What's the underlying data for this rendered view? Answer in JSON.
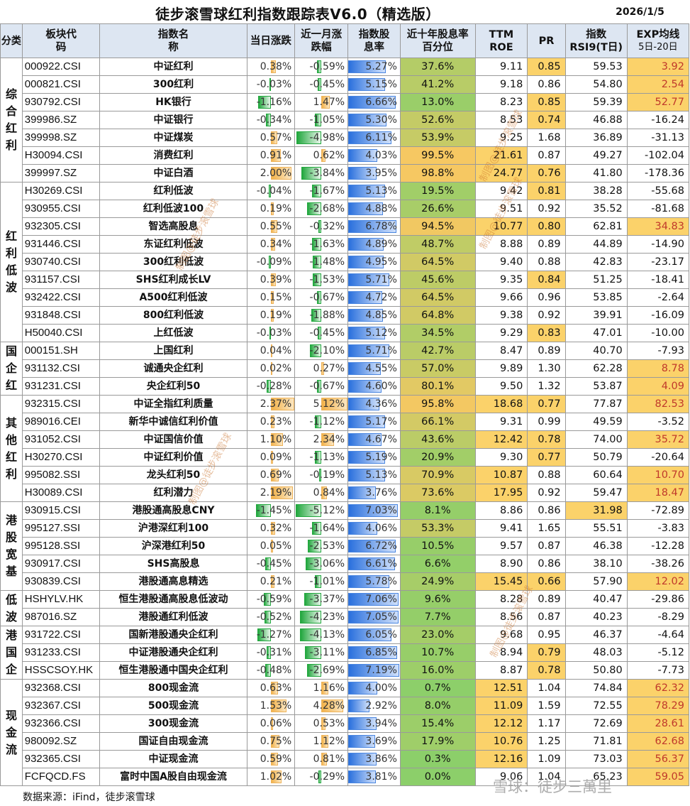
{
  "title": "徒步滚雪球红利指数跟踪表V6.0（精选版）",
  "date": "2026/1/5",
  "headers": {
    "category": "分类",
    "code": "板块代码",
    "name": "指数名称",
    "chg_day": "当日涨跌",
    "chg_month": "近一月涨跌幅",
    "yield": "指数股息率",
    "pctile": "近十年股息率百分位",
    "roe": "TTM ROE",
    "pr": "PR",
    "rsi": "指数RSI9(T日)",
    "exp": "EXP均线",
    "exp_sub": "5日-20日"
  },
  "colors": {
    "pctile_low": "#8ccf6a",
    "pctile_high": "#f7c862",
    "highlight_yellow": "#fbd26a",
    "highlight_pale": "#fdf0c8"
  },
  "groups": [
    {
      "label": "综合红利",
      "rows": [
        {
          "code": "000922.CSI",
          "name": "中证红利",
          "day": "0.38%",
          "month": "-0.59%",
          "yield": "5.27%",
          "pctile": "37.6%",
          "roe": "9.11",
          "pr": "0.85",
          "rsi": "59.53",
          "exp": "3.92"
        },
        {
          "code": "000821.CSI",
          "name": "300红利",
          "day": "-0.03%",
          "month": "-0.45%",
          "yield": "5.15%",
          "pctile": "41.2%",
          "roe": "9.18",
          "pr": "0.86",
          "rsi": "54.80",
          "exp": "2.54"
        },
        {
          "code": "930792.CSI",
          "name": "HK银行",
          "day": "-1.16%",
          "month": "1.47%",
          "yield": "6.66%",
          "pctile": "13.0%",
          "roe": "8.23",
          "pr": "0.85",
          "rsi": "59.39",
          "exp": "52.77"
        },
        {
          "code": "399986.SZ",
          "name": "中证银行",
          "day": "-0.34%",
          "month": "-1.05%",
          "yield": "5.30%",
          "pctile": "52.6%",
          "roe": "8.53",
          "pr": "0.74",
          "rsi": "46.88",
          "exp": "-16.24"
        },
        {
          "code": "399998.SZ",
          "name": "中证煤炭",
          "day": "0.57%",
          "month": "-4.98%",
          "yield": "6.11%",
          "pctile": "53.9%",
          "roe": "9.25",
          "pr": "1.68",
          "rsi": "36.89",
          "exp": "-31.13"
        },
        {
          "code": "H30094.CSI",
          "name": "消费红利",
          "day": "0.91%",
          "month": "0.62%",
          "yield": "4.03%",
          "pctile": "99.5%",
          "roe": "21.61",
          "pr": "0.87",
          "rsi": "49.27",
          "exp": "-102.04"
        },
        {
          "code": "399997.SZ",
          "name": "中证白酒",
          "day": "2.00%",
          "month": "-3.84%",
          "yield": "3.95%",
          "pctile": "98.8%",
          "roe": "24.77",
          "pr": "0.76",
          "rsi": "41.80",
          "exp": "-178.36"
        }
      ]
    },
    {
      "label": "红利低波",
      "rows": [
        {
          "code": "H30269.CSI",
          "name": "红利低波",
          "day": "-0.04%",
          "month": "-1.67%",
          "yield": "5.13%",
          "pctile": "19.5%",
          "roe": "9.42",
          "pr": "0.81",
          "rsi": "38.28",
          "exp": "-55.68"
        },
        {
          "code": "930955.CSI",
          "name": "红利低波100",
          "day": "0.19%",
          "month": "-2.68%",
          "yield": "4.88%",
          "pctile": "26.6%",
          "roe": "9.51",
          "pr": "0.92",
          "rsi": "35.52",
          "exp": "-81.68"
        },
        {
          "code": "932305.CSI",
          "name": "智选高股息",
          "day": "0.55%",
          "month": "-0.32%",
          "yield": "6.78%",
          "pctile": "94.5%",
          "roe": "10.77",
          "pr": "0.80",
          "rsi": "62.81",
          "exp": "34.83"
        },
        {
          "code": "931446.CSI",
          "name": "东证红利低波",
          "day": "0.34%",
          "month": "-1.63%",
          "yield": "4.89%",
          "pctile": "48.7%",
          "roe": "8.88",
          "pr": "0.89",
          "rsi": "44.89",
          "exp": "-14.90"
        },
        {
          "code": "930740.CSI",
          "name": "300红利低波",
          "day": "-0.09%",
          "month": "-1.48%",
          "yield": "4.95%",
          "pctile": "64.5%",
          "roe": "9.40",
          "pr": "0.88",
          "rsi": "42.83",
          "exp": "-23.17"
        },
        {
          "code": "931157.CSI",
          "name": "SHS红利成长LV",
          "day": "0.39%",
          "month": "-1.53%",
          "yield": "5.71%",
          "pctile": "45.6%",
          "roe": "9.35",
          "pr": "0.84",
          "rsi": "51.25",
          "exp": "-18.41"
        },
        {
          "code": "932422.CSI",
          "name": "A500红利低波",
          "day": "0.15%",
          "month": "-0.67%",
          "yield": "4.72%",
          "pctile": "64.5%",
          "roe": "9.66",
          "pr": "0.96",
          "rsi": "53.85",
          "exp": "-2.64"
        },
        {
          "code": "931848.CSI",
          "name": "800红利低波",
          "day": "0.19%",
          "month": "-1.88%",
          "yield": "4.85%",
          "pctile": "64.8%",
          "roe": "9.38",
          "pr": "0.92",
          "rsi": "39.91",
          "exp": "-16.09"
        },
        {
          "code": "H50040.CSI",
          "name": "上红低波",
          "day": "-0.03%",
          "month": "-0.45%",
          "yield": "5.12%",
          "pctile": "34.5%",
          "roe": "9.29",
          "pr": "0.83",
          "rsi": "47.01",
          "exp": "-10.00"
        }
      ]
    },
    {
      "label": "国企红",
      "rows": [
        {
          "code": "000151.SH",
          "name": "上国红利",
          "day": "0.04%",
          "month": "-2.10%",
          "yield": "5.71%",
          "pctile": "42.7%",
          "roe": "8.47",
          "pr": "0.89",
          "rsi": "40.70",
          "exp": "-7.93"
        },
        {
          "code": "931132.CSI",
          "name": "诚通央企红利",
          "day": "0.02%",
          "month": "0.27%",
          "yield": "4.55%",
          "pctile": "57.0%",
          "roe": "9.89",
          "pr": "1.30",
          "rsi": "62.28",
          "exp": "8.78"
        },
        {
          "code": "931231.CSI",
          "name": "央企红利50",
          "day": "-0.28%",
          "month": "-0.67%",
          "yield": "4.60%",
          "pctile": "80.1%",
          "roe": "9.50",
          "pr": "1.32",
          "rsi": "53.87",
          "exp": "4.09"
        }
      ]
    },
    {
      "label": "其他红利",
      "rows": [
        {
          "code": "932315.CSI",
          "name": "中证全指红利质量",
          "day": "2.37%",
          "month": "5.12%",
          "yield": "4.36%",
          "pctile": "95.8%",
          "roe": "18.68",
          "pr": "0.77",
          "rsi": "77.87",
          "exp": "82.53"
        },
        {
          "code": "989016.CEI",
          "name": "新华中诚信红利价值",
          "day": "0.23%",
          "month": "-1.12%",
          "yield": "5.17%",
          "pctile": "66.1%",
          "roe": "9.31",
          "pr": "0.99",
          "rsi": "49.59",
          "exp": "-3.52"
        },
        {
          "code": "931052.CSI",
          "name": "中证国信价值",
          "day": "1.10%",
          "month": "2.34%",
          "yield": "4.67%",
          "pctile": "43.6%",
          "roe": "12.42",
          "pr": "0.78",
          "rsi": "74.00",
          "exp": "35.72"
        },
        {
          "code": "H30270.CSI",
          "name": "中证红利价值",
          "day": "0.09%",
          "month": "-1.13%",
          "yield": "5.19%",
          "pctile": "20.9%",
          "roe": "9.30",
          "pr": "0.77",
          "rsi": "50.79",
          "exp": "-20.64"
        },
        {
          "code": "995082.SSI",
          "name": "龙头红利50",
          "day": "0.69%",
          "month": "-0.19%",
          "yield": "5.13%",
          "pctile": "70.9%",
          "roe": "10.87",
          "pr": "0.88",
          "rsi": "60.64",
          "exp": "10.70"
        },
        {
          "code": "H30089.CSI",
          "name": "红利潜力",
          "day": "2.19%",
          "month": "0.84%",
          "yield": "3.76%",
          "pctile": "73.6%",
          "roe": "17.95",
          "pr": "0.92",
          "rsi": "59.47",
          "exp": "18.47"
        }
      ]
    },
    {
      "label": "港股宽基",
      "rows": [
        {
          "code": "930915.CSI",
          "name": "港股通高股息CNY",
          "day": "-1.45%",
          "month": "-5.12%",
          "yield": "7.03%",
          "pctile": "8.1%",
          "roe": "8.86",
          "pr": "0.86",
          "rsi": "31.98",
          "exp": "-72.89"
        },
        {
          "code": "995127.SSI",
          "name": "沪港深红利100",
          "day": "0.32%",
          "month": "-1.64%",
          "yield": "4.06%",
          "pctile": "53.3%",
          "roe": "9.41",
          "pr": "1.65",
          "rsi": "55.51",
          "exp": "-3.83"
        },
        {
          "code": "995128.SSI",
          "name": "沪深港红利50",
          "day": "0.05%",
          "month": "-2.53%",
          "yield": "6.72%",
          "pctile": "10.5%",
          "roe": "9.57",
          "pr": "0.87",
          "rsi": "46.38",
          "exp": "-12.28"
        },
        {
          "code": "930917.CSI",
          "name": "SHS高股息",
          "day": "-0.45%",
          "month": "-3.06%",
          "yield": "6.61%",
          "pctile": "6.6%",
          "roe": "8.90",
          "pr": "0.86",
          "rsi": "38.10",
          "exp": "-38.26"
        },
        {
          "code": "930839.CSI",
          "name": "港股通高息精选",
          "day": "0.21%",
          "month": "-1.01%",
          "yield": "5.78%",
          "pctile": "24.9%",
          "roe": "15.45",
          "pr": "0.66",
          "rsi": "57.90",
          "exp": "12.02"
        }
      ]
    },
    {
      "label": "低波",
      "rows": [
        {
          "code": "HSHYLV.HK",
          "name": "恒生港股通高股息低波动",
          "day": "-0.59%",
          "month": "-3.37%",
          "yield": "7.06%",
          "pctile": "9.6%",
          "roe": "8.28",
          "pr": "0.89",
          "rsi": "40.47",
          "exp": "-29.86"
        },
        {
          "code": "987016.SZ",
          "name": "港股通红利低波",
          "day": "-0.52%",
          "month": "-4.23%",
          "yield": "7.05%",
          "pctile": "7.7%",
          "roe": "8.56",
          "pr": "0.87",
          "rsi": "40.23",
          "exp": "-8.29"
        }
      ]
    },
    {
      "label": "港国企",
      "rows": [
        {
          "code": "931722.CSI",
          "name": "国新港股通央企红利",
          "day": "-1.27%",
          "month": "-4.13%",
          "yield": "6.05%",
          "pctile": "23.0%",
          "roe": "9.68",
          "pr": "0.95",
          "rsi": "46.37",
          "exp": "-4.64"
        },
        {
          "code": "931233.CSI",
          "name": "中证港股通央企红利",
          "day": "-0.31%",
          "month": "-3.11%",
          "yield": "6.85%",
          "pctile": "10.7%",
          "roe": "8.94",
          "pr": "0.79",
          "rsi": "48.03",
          "exp": "-5.12"
        },
        {
          "code": "HSSCSOY.HK",
          "name": "恒生港股通中国央企红利",
          "day": "-0.48%",
          "month": "-2.69%",
          "yield": "7.19%",
          "pctile": "16.0%",
          "roe": "8.87",
          "pr": "0.78",
          "rsi": "50.80",
          "exp": "-7.73"
        }
      ]
    },
    {
      "label": "现金流",
      "rows": [
        {
          "code": "932368.CSI",
          "name": "800现金流",
          "day": "0.63%",
          "month": "1.16%",
          "yield": "4.00%",
          "pctile": "0.7%",
          "roe": "12.51",
          "pr": "1.04",
          "rsi": "74.84",
          "exp": "62.32"
        },
        {
          "code": "932367.CSI",
          "name": "500现金流",
          "day": "1.53%",
          "month": "4.28%",
          "yield": "2.92%",
          "pctile": "8.0%",
          "roe": "11.09",
          "pr": "1.59",
          "rsi": "72.55",
          "exp": "78.29"
        },
        {
          "code": "932366.CSI",
          "name": "300现金流",
          "day": "0.06%",
          "month": "0.53%",
          "yield": "3.94%",
          "pctile": "15.4%",
          "roe": "12.12",
          "pr": "1.17",
          "rsi": "72.69",
          "exp": "28.61"
        },
        {
          "code": "980092.SZ",
          "name": "国证自由现金流",
          "day": "0.75%",
          "month": "1.12%",
          "yield": "3.69%",
          "pctile": "17.9%",
          "roe": "10.76",
          "pr": "1.25",
          "rsi": "71.81",
          "exp": "62.68"
        },
        {
          "code": "932365.CSI",
          "name": "中证现金流",
          "day": "0.59%",
          "month": "0.81%",
          "yield": "3.86%",
          "pctile": "0.3%",
          "roe": "12.16",
          "pr": "1.09",
          "rsi": "73.03",
          "exp": "56.37"
        },
        {
          "code": "FCFQCD.FS",
          "name": "富时中国A股自由现金流",
          "day": "1.02%",
          "month": "-0.29%",
          "yield": "3.81%",
          "pctile": "0.0%",
          "roe": "9.06",
          "pr": "1.04",
          "rsi": "65.23",
          "exp": "59.05"
        }
      ]
    }
  ],
  "footer": "数据来源：iFind，徒步滚雪球",
  "watermarks": [
    "制图@徒步滚雪球",
    "制图@徒步滚雪球",
    "制图@徒步滚雪球",
    "制图@徒步滚雪球",
    "制图@徒步滚雪球"
  ],
  "brand_watermark": "雪球：徒步三萬里"
}
